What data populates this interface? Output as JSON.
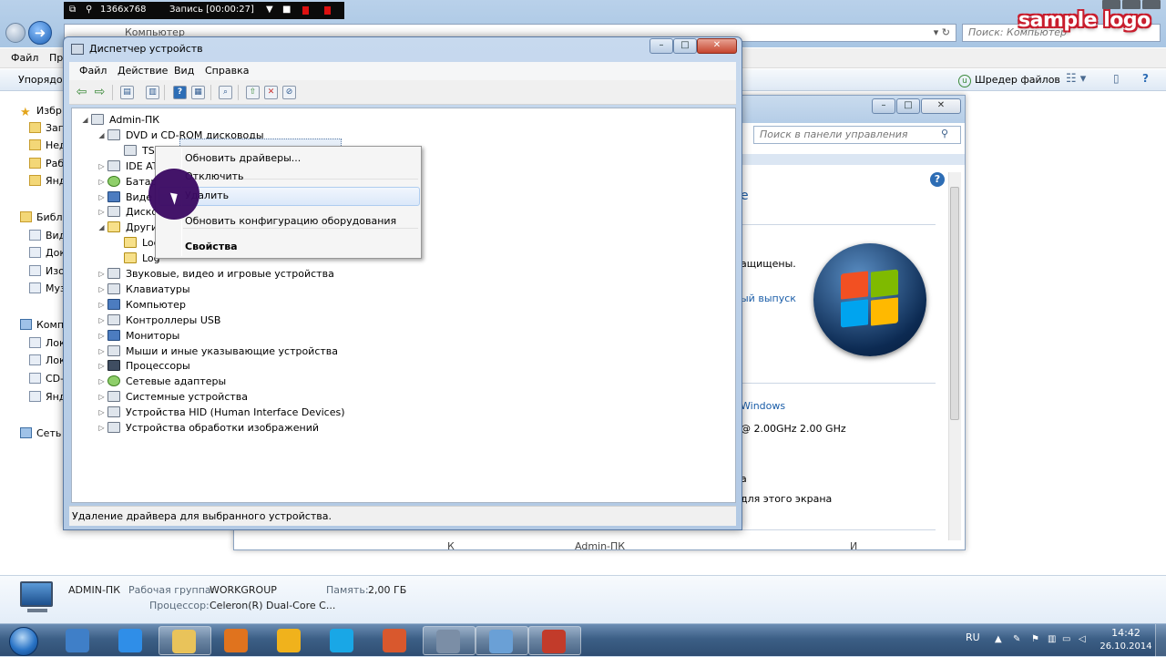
{
  "recorder": {
    "resolution": "1366x768",
    "status": "Запись [00:00:27]"
  },
  "watermark": "sample logo",
  "explorer": {
    "address": "Компьютер",
    "search_placeholder": "Поиск: Компьютер",
    "menu": [
      "Файл",
      "Пр"
    ],
    "toolbar_organize": "Упорядоч",
    "toolbar_shredder": "Шредер файлов",
    "sidebar": [
      {
        "label": "Избр",
        "icon": "star-icon",
        "kind": "star"
      },
      {
        "label": "Загр",
        "icon": "folder-icon",
        "kind": "folder",
        "sub": true
      },
      {
        "label": "Нед",
        "icon": "folder-icon",
        "kind": "folder",
        "sub": true
      },
      {
        "label": "Раб",
        "icon": "folder-icon",
        "kind": "folder",
        "sub": true
      },
      {
        "label": "Янд",
        "icon": "folder-icon",
        "kind": "folder",
        "sub": true
      },
      {
        "label": "Библ",
        "icon": "library-icon",
        "kind": "folder"
      },
      {
        "label": "Вид",
        "icon": "video-icon",
        "kind": "",
        "sub": true
      },
      {
        "label": "Док",
        "icon": "document-icon",
        "kind": "",
        "sub": true
      },
      {
        "label": "Изо",
        "icon": "image-icon",
        "kind": "",
        "sub": true
      },
      {
        "label": "Муз",
        "icon": "music-icon",
        "kind": "",
        "sub": true
      },
      {
        "label": "Комп",
        "icon": "computer-icon",
        "kind": "net"
      },
      {
        "label": "Лок",
        "icon": "disk-icon",
        "kind": "",
        "sub": true
      },
      {
        "label": "Лок",
        "icon": "disk-icon",
        "kind": "",
        "sub": true
      },
      {
        "label": "CD-",
        "icon": "cd-icon",
        "kind": "",
        "sub": true
      },
      {
        "label": "Янд",
        "icon": "disk-icon",
        "kind": "",
        "sub": true
      },
      {
        "label": "Сеть",
        "icon": "network-icon",
        "kind": "net"
      }
    ]
  },
  "control_panel": {
    "search_placeholder": "Поиск в панели управления",
    "frag_e": "е",
    "frag_protected": "ащищены.",
    "frag_release": "ый выпуск",
    "frag_windows": "Windows",
    "frag_cpu": "@ 2.00GHz   2.00 GHz",
    "frag_a": "а",
    "frag_screen": "для этого экрана",
    "frag_bottom1": "К",
    "frag_bottom2": "Admin-ПК",
    "frag_bottom3": "И"
  },
  "device_manager": {
    "title": "Диспетчер устройств",
    "menu": [
      "Файл",
      "Действие",
      "Вид",
      "Справка"
    ],
    "tree": [
      {
        "label": "Admin-ПК",
        "level": 0,
        "expander": "◢",
        "icon": "computer-icon",
        "kind": ""
      },
      {
        "label": "DVD и CD-ROM дисководы",
        "level": 1,
        "expander": "◢",
        "icon": "cd-drive-icon",
        "kind": ""
      },
      {
        "label": "TSSTcorp CDDVDW TS-L633C",
        "level": 2,
        "expander": "",
        "icon": "cd-drive-icon",
        "kind": ""
      },
      {
        "label": "IDE AT",
        "level": 1,
        "expander": "▷",
        "icon": "ide-icon",
        "kind": ""
      },
      {
        "label": "Батаре",
        "level": 1,
        "expander": "▷",
        "icon": "battery-icon",
        "kind": "green"
      },
      {
        "label": "Виде",
        "level": 1,
        "expander": "▷",
        "icon": "display-adapter-icon",
        "kind": "blue"
      },
      {
        "label": "Диско",
        "level": 1,
        "expander": "▷",
        "icon": "disk-drive-icon",
        "kind": ""
      },
      {
        "label": "Други",
        "level": 1,
        "expander": "◢",
        "icon": "unknown-device-icon",
        "kind": "warn"
      },
      {
        "label": "Log",
        "level": 2,
        "expander": "",
        "icon": "warning-device-icon",
        "kind": "warn"
      },
      {
        "label": "Log",
        "level": 2,
        "expander": "",
        "icon": "warning-device-icon",
        "kind": "warn"
      },
      {
        "label": "Звуковые, видео и игровые устройства",
        "level": 1,
        "expander": "▷",
        "icon": "speaker-icon",
        "kind": ""
      },
      {
        "label": "Клавиатуры",
        "level": 1,
        "expander": "▷",
        "icon": "keyboard-icon",
        "kind": ""
      },
      {
        "label": "Компьютер",
        "level": 1,
        "expander": "▷",
        "icon": "computer-icon",
        "kind": "blue"
      },
      {
        "label": "Контроллеры USB",
        "level": 1,
        "expander": "▷",
        "icon": "usb-icon",
        "kind": ""
      },
      {
        "label": "Мониторы",
        "level": 1,
        "expander": "▷",
        "icon": "monitor-icon",
        "kind": "blue"
      },
      {
        "label": "Мыши и иные указывающие устройства",
        "level": 1,
        "expander": "▷",
        "icon": "mouse-icon",
        "kind": ""
      },
      {
        "label": "Процессоры",
        "level": 1,
        "expander": "▷",
        "icon": "processor-icon",
        "kind": "dark"
      },
      {
        "label": "Сетевые адаптеры",
        "level": 1,
        "expander": "▷",
        "icon": "network-adapter-icon",
        "kind": "green"
      },
      {
        "label": "Системные устройства",
        "level": 1,
        "expander": "▷",
        "icon": "system-device-icon",
        "kind": ""
      },
      {
        "label": "Устройства HID (Human Interface Devices)",
        "level": 1,
        "expander": "▷",
        "icon": "hid-icon",
        "kind": ""
      },
      {
        "label": "Устройства обработки изображений",
        "level": 1,
        "expander": "▷",
        "icon": "imaging-icon",
        "kind": ""
      }
    ],
    "status": "Удаление драйвера для выбранного устройства."
  },
  "context_menu": {
    "items": [
      "Обновить драйверы...",
      "Отключить",
      "Удалить",
      "Обновить конфигурацию оборудования",
      "Свойства"
    ]
  },
  "details": {
    "computer_name": "ADMIN-ПК",
    "workgroup_label": "Рабочая группа:",
    "workgroup": "WORKGROUP",
    "memory_label": "Память:",
    "memory": "2,00 ГБ",
    "cpu_label": "Процессор:",
    "cpu": "Celeron(R) Dual-Core C..."
  },
  "taskbar": {
    "lang": "RU",
    "time": "14:42",
    "date": "26.10.2014",
    "items": [
      {
        "name": "taskbar-ccleaner",
        "color": "#3f7fc8",
        "open": false
      },
      {
        "name": "taskbar-internet-explorer",
        "color": "#2f8ee8",
        "open": false
      },
      {
        "name": "taskbar-explorer",
        "color": "#e9c35a",
        "open": true
      },
      {
        "name": "taskbar-media-player",
        "color": "#e0731e",
        "open": false
      },
      {
        "name": "taskbar-aimp",
        "color": "#f0b21c",
        "open": false
      },
      {
        "name": "taskbar-skype",
        "color": "#19a7e6",
        "open": false
      },
      {
        "name": "taskbar-browser",
        "color": "#d9582d",
        "open": false
      },
      {
        "name": "taskbar-device-manager",
        "color": "#7b8ea6",
        "open": true
      },
      {
        "name": "taskbar-control-panel",
        "color": "#6aa0d6",
        "open": true
      },
      {
        "name": "taskbar-toolbox",
        "color": "#c23b2a",
        "open": true
      }
    ]
  }
}
